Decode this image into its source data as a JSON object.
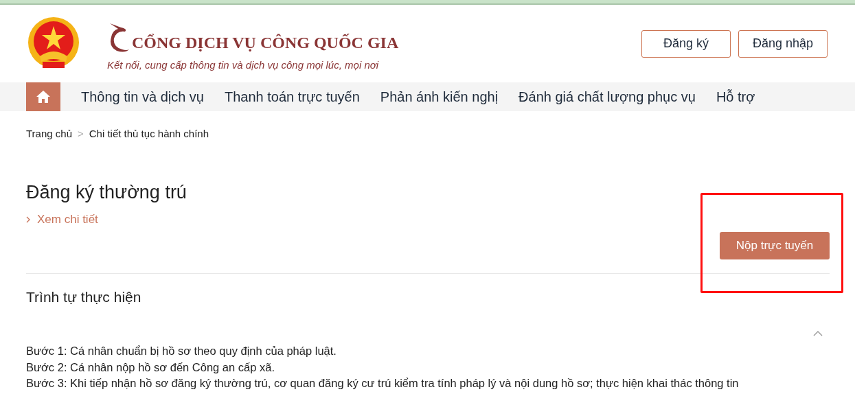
{
  "header": {
    "title": "CỔNG DỊCH VỤ CÔNG QUỐC GIA",
    "slogan": "Kết nối, cung cấp thông tin và dịch vụ công mọi lúc, mọi nơi",
    "buttons": [
      "Đăng ký",
      "Đăng nhập"
    ]
  },
  "nav": {
    "items": [
      {
        "label": "Thông tin và dịch vụ"
      },
      {
        "label": "Thanh toán trực tuyến"
      },
      {
        "label": "Phản ánh kiến nghị"
      },
      {
        "label": "Đánh giá chất lượng phục vụ"
      },
      {
        "label": "Hỗ trợ"
      }
    ]
  },
  "breadcrumb": [
    "Trang chủ",
    "Chi tiết thủ tục hành chính"
  ],
  "breadcrumb_separator": ">",
  "procedure": {
    "title": "Đăng ký thường trú",
    "details_link": "Xem chi tiết",
    "submit_button": "Nộp trực tuyến",
    "highlighted": true
  },
  "section": {
    "title": "Trình tự thực hiện",
    "expanded": true,
    "steps": [
      "Bước 1: Cá nhân chuẩn bị hồ sơ theo quy định của pháp luật.",
      "Bước 2: Cá nhân nộp hồ sơ đến Công an cấp xã.",
      "Bước 3: Khi tiếp nhận hồ sơ đăng ký thường trú, cơ quan đăng ký cư trú kiểm tra tính pháp lý và nội dung hồ sơ; thực hiện khai thác thông tin"
    ]
  }
}
